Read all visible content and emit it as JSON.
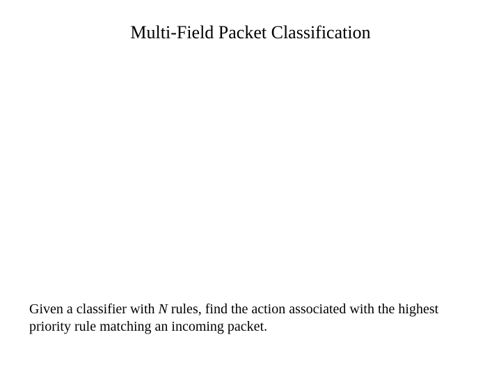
{
  "title": "Multi-Field Packet Classification",
  "body": {
    "part1": "Given a classifier with ",
    "italic": "N",
    "part2": " rules, find the action associated with the highest priority rule  matching an incoming packet."
  }
}
